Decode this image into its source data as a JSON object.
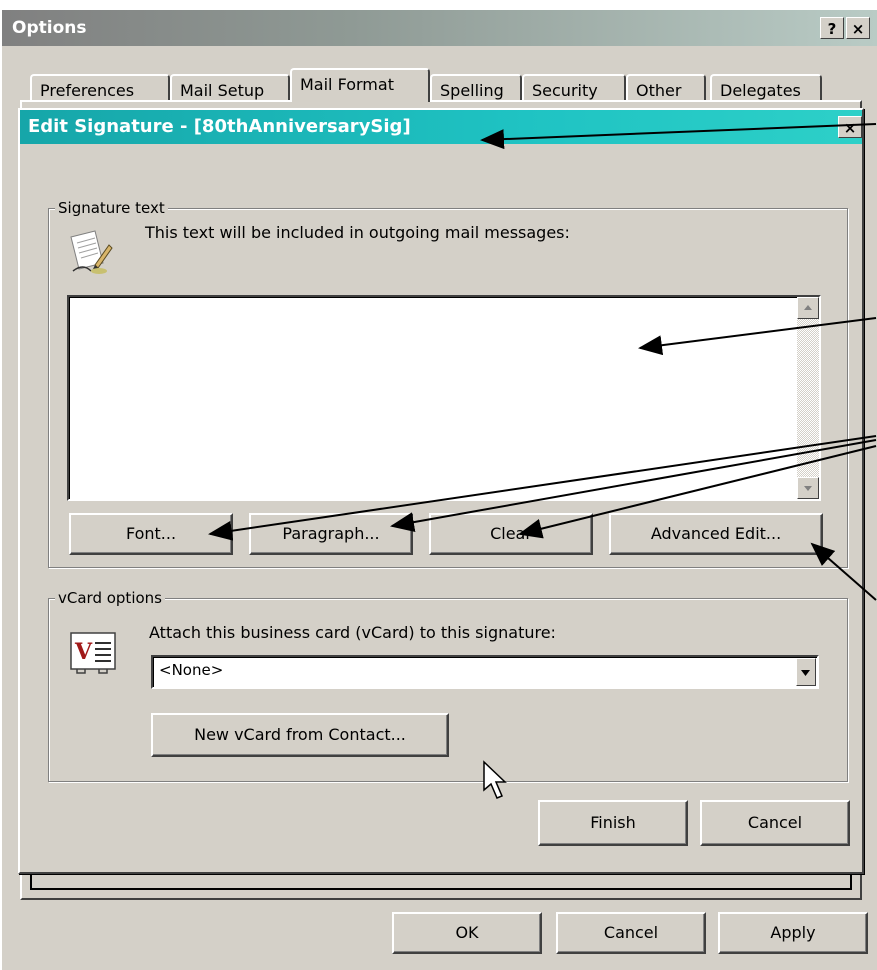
{
  "options_window": {
    "title": "Options",
    "help_button": "?",
    "close_button": "×",
    "tabs": [
      {
        "label": "Preferences"
      },
      {
        "label": "Mail Setup"
      },
      {
        "label": "Mail Format"
      },
      {
        "label": "Spelling"
      },
      {
        "label": "Security"
      },
      {
        "label": "Other"
      },
      {
        "label": "Delegates"
      }
    ],
    "active_tab": "Mail Format",
    "buttons": {
      "ok": "OK",
      "cancel": "Cancel",
      "apply": "Apply"
    }
  },
  "edit_signature": {
    "title": "Edit Signature - [80thAnniversarySig]",
    "close_button": "×",
    "signature_group": {
      "label": "Signature text",
      "description": "This text will be included in outgoing mail messages:",
      "text_value": "",
      "buttons": {
        "font": "Font...",
        "paragraph": "Paragraph...",
        "clear": "Clear",
        "advanced_edit": "Advanced Edit..."
      }
    },
    "vcard_group": {
      "label": "vCard options",
      "description": "Attach this business card (vCard) to this signature:",
      "selected_vcard": "<None>",
      "new_vcard_button": "New vCard from Contact..."
    },
    "buttons": {
      "finish": "Finish",
      "cancel": "Cancel"
    }
  }
}
